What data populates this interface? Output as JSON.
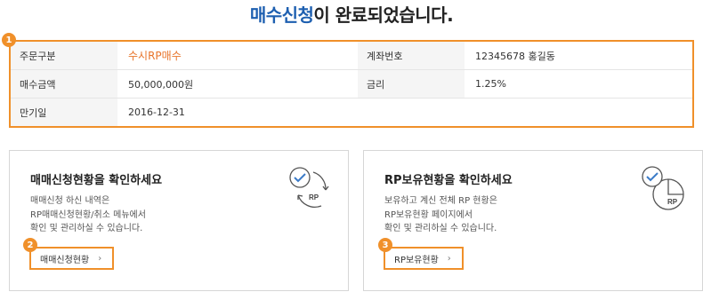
{
  "header": {
    "title_highlight": "매수신청",
    "title_rest": "이 완료되었습니다."
  },
  "colors": {
    "accent_orange": "#f0902a",
    "title_blue": "#1d5fb0",
    "icon_blue": "#3b7bc8"
  },
  "summary": {
    "badge": "1",
    "rows": [
      {
        "label1": "주문구분",
        "value1": "수시RP매수",
        "label2": "계좌번호",
        "value2": "12345678 홍길동"
      },
      {
        "label1": "매수금액",
        "value1": "50,000,000원",
        "label2": "금리",
        "value2": "1.25%"
      },
      {
        "label1": "만기일",
        "value1": "2016-12-31"
      }
    ]
  },
  "cards": [
    {
      "title": "매매신청현황을 확인하세요",
      "lines": [
        "매매신청 하신 내역은",
        "RP매매신청현황/취소 메뉴에서",
        "확인 및 관리하실 수 있습니다."
      ],
      "button": "매매신청현황",
      "badge": "2",
      "icon_label": "RP",
      "icon": "check-cycle-rp-icon"
    },
    {
      "title": "RP보유현황을 확인하세요",
      "lines": [
        "보유하고 계신 전체 RP 현황은",
        "RP보유현황 페이지에서",
        "확인 및 관리하실 수 있습니다."
      ],
      "button": "RP보유현황",
      "badge": "3",
      "icon_label": "RP",
      "icon": "check-pie-rp-icon"
    }
  ],
  "chevron": "›"
}
